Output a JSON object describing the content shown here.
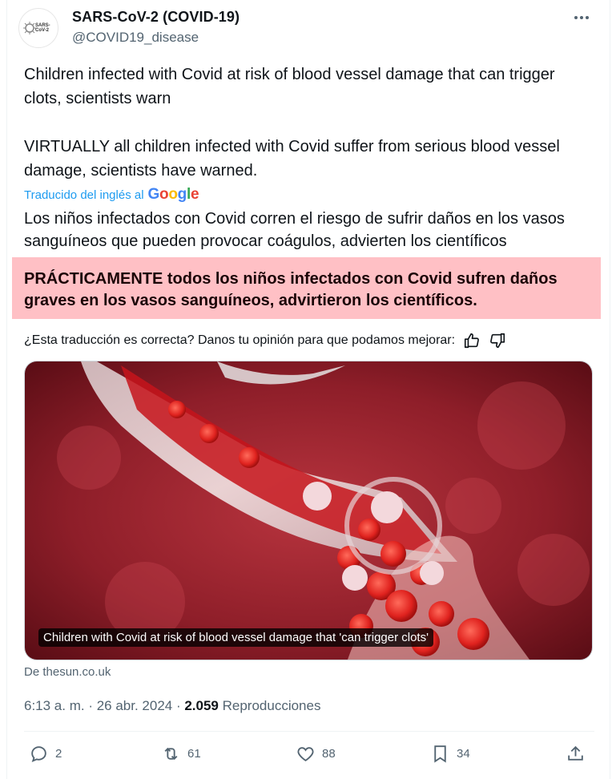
{
  "author": {
    "avatar_text": "SARS-CoV-2",
    "name": "SARS-CoV-2 (COVID-19)",
    "handle": "@COVID19_disease"
  },
  "tweet": {
    "text": "Children infected with Covid at risk of blood vessel damage that can trigger clots, scientists warn\n\nVIRTUALLY all children infected with Covid suffer from serious blood vessel damage, scientists have warned."
  },
  "translation": {
    "label": "Traducido del inglés al",
    "provider": "Google",
    "text": "Los niños infectados con Covid corren el riesgo de sufrir daños en los vasos sanguíneos que pueden provocar coágulos, advierten los científicos",
    "highlight": "PRÁCTICAMENTE todos los niños infectados con Covid sufren daños graves en los vasos sanguíneos, advirtieron los científicos.",
    "feedback_prompt": "¿Esta traducción es correcta? Danos tu opinión para que podamos mejorar:"
  },
  "media": {
    "caption": "Children with Covid at risk of blood vessel damage that 'can trigger clots'",
    "source": "De thesun.co.uk"
  },
  "meta": {
    "time": "6:13 a. m. · 26 abr. 2024 · ",
    "views": "2.059",
    "views_label": " Reproducciones"
  },
  "actions": {
    "replies": "2",
    "reposts": "61",
    "likes": "88",
    "bookmarks": "34"
  },
  "colors": {
    "highlight_bg": "#ffc0c5",
    "link_blue": "#1d9bf0",
    "secondary_text": "#536471"
  },
  "icons": [
    "more-icon",
    "thumbs-up-icon",
    "thumbs-down-icon",
    "reply-icon",
    "repost-icon",
    "like-icon",
    "bookmark-icon",
    "share-icon"
  ]
}
